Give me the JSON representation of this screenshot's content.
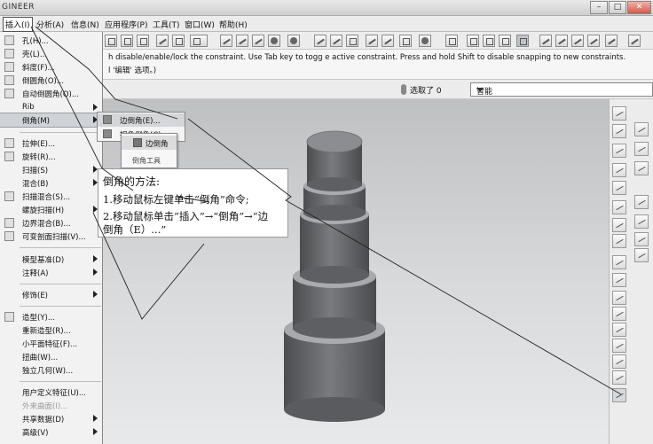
{
  "window": {
    "title": "GINEER",
    "minimize_label": "–",
    "maximize_label": "□",
    "close_label": "✕"
  },
  "menubar": {
    "items": [
      "插入(I)",
      "分析(A)",
      "信息(N)",
      "应用程序(P)",
      "工具(T)",
      "窗口(W)",
      "帮助(H)"
    ]
  },
  "message": {
    "line1": "h disable/enable/lock the constraint. Use Tab key to togg e active constraint. Press and hold Shift to disable snapping to new constraints.",
    "line2": "l '编辑' 选项。)"
  },
  "filter": {
    "label": "选取了 0",
    "value": "智能"
  },
  "insert_menu": {
    "group1": [
      "孔(H)...",
      "壳(L)...",
      "斜度(F)...",
      "倒圆角(O)...",
      "自动倒圆角(O)..."
    ],
    "rib": "Rib",
    "chamfer": "倒角(M)",
    "group2": [
      "拉伸(E)...",
      "旋转(R)...",
      "扫描(S)",
      "混合(B)",
      "扫描混合(S)...",
      "螺旋扫描(H)",
      "边界混合(B)...",
      "可变剖面扫描(V)..."
    ],
    "group3": [
      "模型基准(D)",
      "注释(A)"
    ],
    "group4": [
      "修饰(E)"
    ],
    "group5": [
      "造型(Y)...",
      "重新造型(R)...",
      "小平面特征(F)...",
      "扭曲(W)...",
      "独立几何(W)..."
    ],
    "group6": [
      "用户定义特征(U)...",
      "外来曲面(I)...",
      "共享数据(D)",
      "高级(V)"
    ]
  },
  "chamfer_submenu": {
    "items": [
      "边倒角(E)...",
      "拐角倒角(C)..."
    ]
  },
  "popup": {
    "title": "边倒角",
    "caption": "倒角工具"
  },
  "annotation": {
    "heading": "倒角的方法:",
    "step1": "1.移动鼠标左键单击“倒角”命令;",
    "step2": "2.移动鼠标单击“插入”→“倒角”→“边",
    "step2b": "倒角（E）...”"
  },
  "colors": {
    "viewport_top": "#bfc0c2",
    "viewport_bottom": "#e8e9ea",
    "model_body": "#6f7073",
    "model_chamfer": "#a9aaad",
    "menu_bg": "#f2f2f2"
  }
}
